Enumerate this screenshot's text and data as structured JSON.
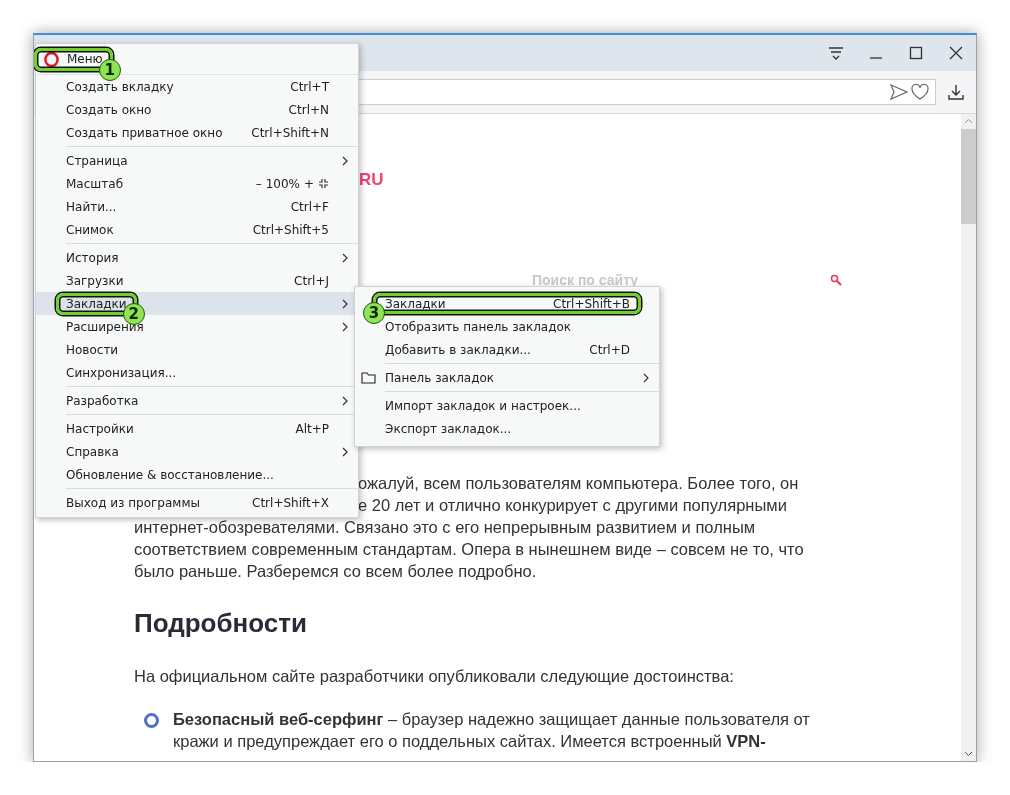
{
  "page": {
    "logo": "RU",
    "search": {
      "placeholder": "Поиск по сайту"
    },
    "intro_lines": [
      {
        "kind": "clipped",
        "text": "ожалуй, всем пользователям компьютера. Более того, он"
      },
      {
        "kind": "clipped",
        "text": "е 20 лет и отлично конкурирует с другими популярными"
      },
      {
        "kind": "full",
        "text": "интернет-обозревателями. Связано это с его непрерывным развитием и полным"
      },
      {
        "kind": "full",
        "text": "соответствием современным стандартам. Опера в нынешнем виде – совсем не то, что"
      },
      {
        "kind": "full",
        "text": "было раньше. Разберемся со всем более подробно."
      }
    ],
    "heading": "Подробности",
    "lead": "На официальном сайте разработчики опубликовали следующие достоинства:",
    "list": [
      {
        "lines": [
          "**Безопасный веб-серфинг** – браузер надежно защищает данные пользователя от",
          "кражи и предупреждает его о поддельных сайтах. Имеется встроенный **VPN-**"
        ]
      }
    ]
  },
  "menu": {
    "header": {
      "label": "Меню",
      "callout": "1"
    },
    "sections": [
      [
        {
          "kind": "item",
          "label": "Создать вкладку",
          "shortcut": "Ctrl+T",
          "has_submenu": false,
          "selected": false
        },
        {
          "kind": "item",
          "label": "Создать окно",
          "shortcut": "Ctrl+N",
          "has_submenu": false,
          "selected": false
        },
        {
          "kind": "item",
          "label": "Создать приватное окно",
          "shortcut": "Ctrl+Shift+N",
          "has_submenu": false,
          "selected": false
        }
      ],
      [
        {
          "kind": "item",
          "label": "Страница",
          "has_submenu": true,
          "selected": false
        },
        {
          "kind": "zoom",
          "label": "Масштаб",
          "zoom_out": "–",
          "zoom_value": "100%",
          "zoom_in": "+",
          "has_submenu": false,
          "selected": false
        },
        {
          "kind": "item",
          "label": "Найти...",
          "shortcut": "Ctrl+F",
          "has_submenu": false,
          "selected": false
        },
        {
          "kind": "item",
          "label": "Снимок",
          "shortcut": "Ctrl+Shift+5",
          "has_submenu": false,
          "selected": false
        }
      ],
      [
        {
          "kind": "item",
          "label": "История",
          "has_submenu": true,
          "selected": false
        },
        {
          "kind": "item",
          "label": "Загрузки",
          "shortcut": "Ctrl+J",
          "has_submenu": false,
          "selected": false
        },
        {
          "kind": "item",
          "label": "Закладки",
          "has_submenu": true,
          "selected": true,
          "callout": "2"
        },
        {
          "kind": "item",
          "label": "Расширения",
          "has_submenu": true,
          "selected": false
        },
        {
          "kind": "item",
          "label": "Новости",
          "has_submenu": false,
          "selected": false
        },
        {
          "kind": "item",
          "label": "Синхронизация...",
          "has_submenu": false,
          "selected": false
        }
      ],
      [
        {
          "kind": "item",
          "label": "Разработка",
          "has_submenu": true,
          "selected": false
        }
      ],
      [
        {
          "kind": "item",
          "label": "Настройки",
          "shortcut": "Alt+P",
          "has_submenu": false,
          "selected": false
        },
        {
          "kind": "item",
          "label": "Справка",
          "has_submenu": true,
          "selected": false
        },
        {
          "kind": "item",
          "label": "Обновление & восстановление...",
          "has_submenu": false,
          "selected": false
        }
      ],
      [
        {
          "kind": "item",
          "label": "Выход из программы",
          "shortcut": "Ctrl+Shift+X",
          "has_submenu": false,
          "selected": false
        }
      ]
    ]
  },
  "submenu": {
    "sections": [
      [
        {
          "label": "Закладки",
          "shortcut": "Ctrl+Shift+B",
          "has_submenu": false,
          "folder": false,
          "callout": "3"
        },
        {
          "label": "Отобразить панель закладок",
          "has_submenu": false,
          "folder": false
        },
        {
          "label": "Добавить в закладки...",
          "shortcut": "Ctrl+D",
          "has_submenu": false,
          "folder": false
        }
      ],
      [
        {
          "label": "Панель закладок",
          "has_submenu": true,
          "folder": true
        }
      ],
      [
        {
          "label": "Импорт закладок и настроек...",
          "has_submenu": false,
          "folder": false
        },
        {
          "label": "Экспорт закладок...",
          "has_submenu": false,
          "folder": false
        }
      ]
    ]
  }
}
